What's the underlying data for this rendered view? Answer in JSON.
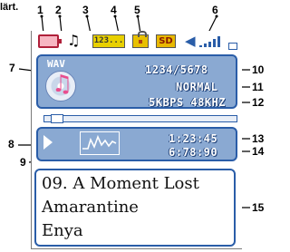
{
  "caption_fragment": "lärt.",
  "callouts": [
    "1",
    "2",
    "3",
    "4",
    "5",
    "6",
    "7",
    "8",
    "9",
    "10",
    "11",
    "12",
    "13",
    "14",
    "15"
  ],
  "status_bar": {
    "counter_text": "123...",
    "sd_text": "SD",
    "volume_level_bars": 5,
    "icons": [
      "battery-icon",
      "music-note-icon",
      "counter-icon",
      "lock-icon",
      "sd-card-icon",
      "speaker-icon"
    ]
  },
  "info_panel": {
    "format": "WAV",
    "track_counter": "1234/5678",
    "play_mode": "NORMAL",
    "bitrate_samplerate": "5KBPS 48KHZ"
  },
  "playback": {
    "progress_fraction": 0.04,
    "elapsed_time": "1:23:45",
    "total_time": "6:78:90"
  },
  "track_info": {
    "line1": "09. A Moment Lost",
    "line2": "Amarantine",
    "line3": "Enya"
  },
  "colors": {
    "panel": "#8aa9d2",
    "panel_border": "#2a5da8",
    "battery": "#b0203a",
    "badge_yellow": "#e8c000"
  }
}
